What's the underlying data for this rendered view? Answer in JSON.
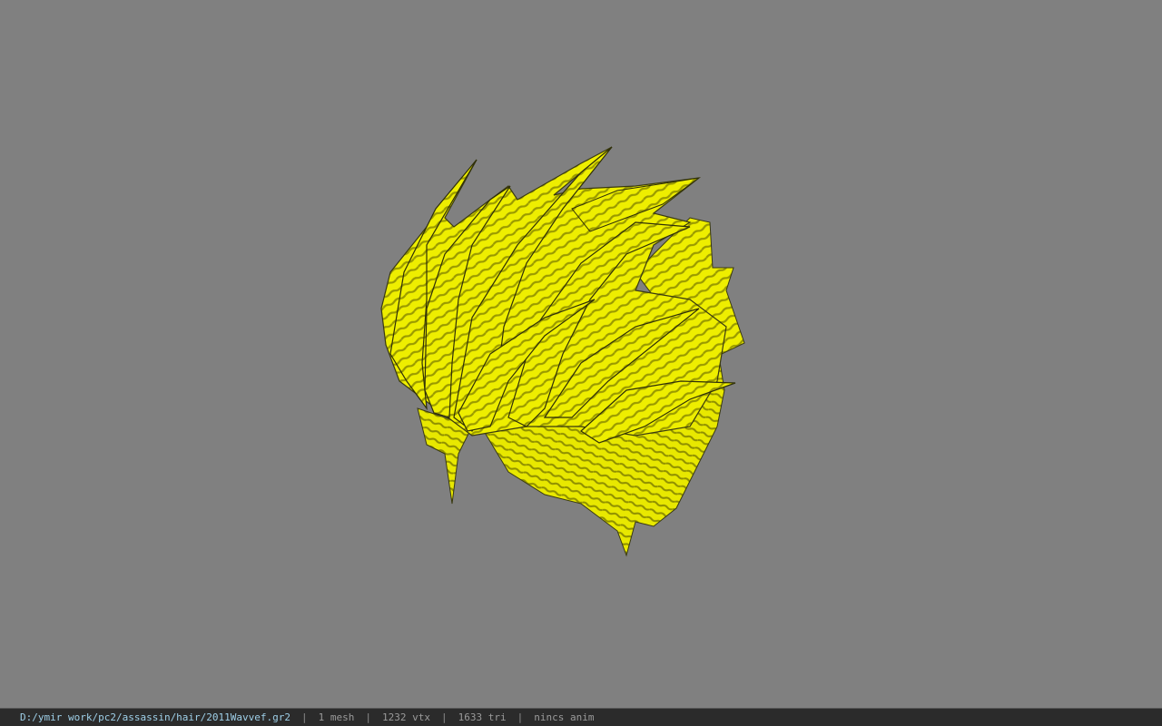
{
  "viewport": {
    "background": "#808080",
    "model": {
      "icon": "hair-mesh-model",
      "color": "#f0f000",
      "shade_color": "#9a9a00",
      "outline_color": "#3a3a10"
    }
  },
  "status_bar": {
    "file_path": "D:/ymir work/pc2/assassin/hair/2011Wavvef.gr2",
    "separator": "|",
    "mesh_count": "1 mesh",
    "vertex_count": "1232 vtx",
    "triangle_count": "1633 tri",
    "anim_status": "nincs anim"
  }
}
